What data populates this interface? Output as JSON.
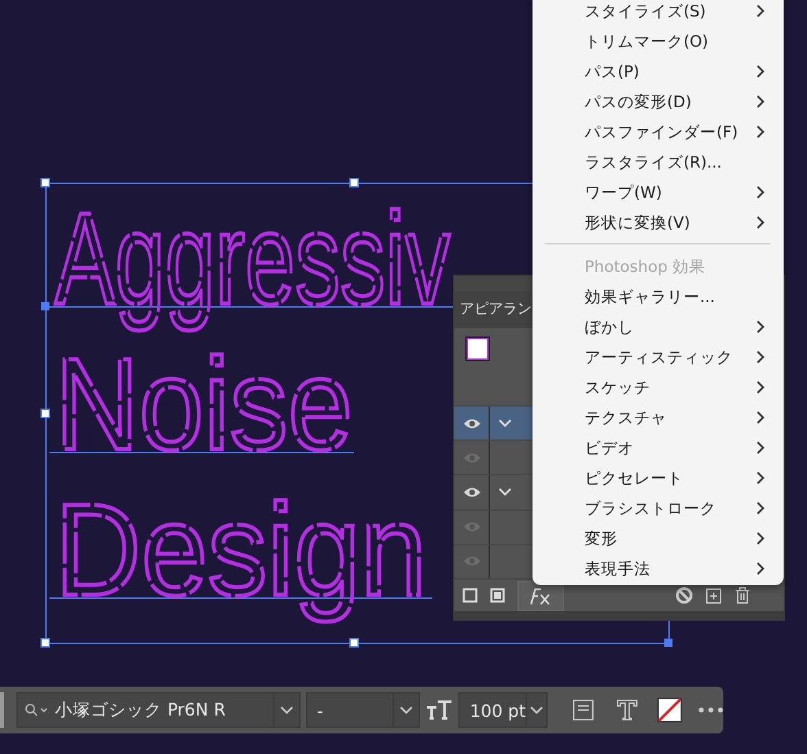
{
  "canvas": {
    "lines": [
      "Aggressiv",
      "Noise",
      "Design"
    ]
  },
  "appearance_panel": {
    "title": "アピアラン",
    "rows": [
      {
        "visible": true,
        "has_children": true,
        "selected": true
      },
      {
        "visible": false,
        "has_children": false,
        "selected": false
      },
      {
        "visible": true,
        "has_children": true,
        "selected": false
      },
      {
        "visible": false,
        "has_children": false,
        "selected": false
      },
      {
        "visible": false,
        "has_children": false,
        "selected": false
      }
    ]
  },
  "context_menu": {
    "items": [
      {
        "kind": "item",
        "label": "スタイライズ(S)",
        "submenu": true
      },
      {
        "kind": "item",
        "label": "トリムマーク(O)",
        "submenu": false
      },
      {
        "kind": "item",
        "label": "パス(P)",
        "submenu": true
      },
      {
        "kind": "item",
        "label": "パスの変形(D)",
        "submenu": true
      },
      {
        "kind": "item",
        "label": "パスファインダー(F)",
        "submenu": true
      },
      {
        "kind": "item",
        "label": "ラスタライズ(R)...",
        "submenu": false
      },
      {
        "kind": "item",
        "label": "ワープ(W)",
        "submenu": true
      },
      {
        "kind": "item",
        "label": "形状に変換(V)",
        "submenu": true
      },
      {
        "kind": "separator"
      },
      {
        "kind": "heading",
        "label": "Photoshop 効果"
      },
      {
        "kind": "item",
        "label": "効果ギャラリー...",
        "submenu": false
      },
      {
        "kind": "item",
        "label": "ぼかし",
        "submenu": true
      },
      {
        "kind": "item",
        "label": "アーティスティック",
        "submenu": true
      },
      {
        "kind": "item",
        "label": "スケッチ",
        "submenu": true
      },
      {
        "kind": "item",
        "label": "テクスチャ",
        "submenu": true
      },
      {
        "kind": "item",
        "label": "ビデオ",
        "submenu": true
      },
      {
        "kind": "item",
        "label": "ピクセレート",
        "submenu": true
      },
      {
        "kind": "item",
        "label": "ブラシストローク",
        "submenu": true
      },
      {
        "kind": "item",
        "label": "変形",
        "submenu": true
      },
      {
        "kind": "item",
        "label": "表現手法",
        "submenu": true
      }
    ]
  },
  "text_toolbar": {
    "font_family": "小塚ゴシック Pr6N R",
    "font_style": "-",
    "font_size": "100 pt"
  }
}
